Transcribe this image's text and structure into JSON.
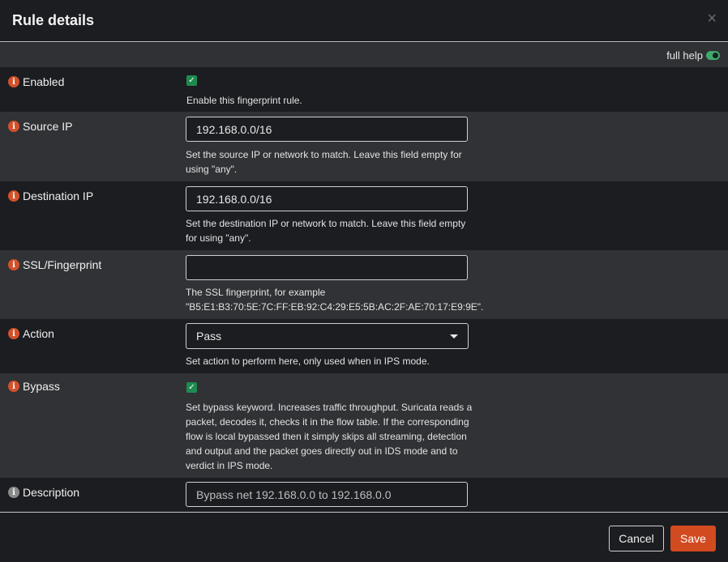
{
  "modal": {
    "title": "Rule details",
    "close_label": "×",
    "full_help_label": "full help"
  },
  "fields": {
    "enabled": {
      "label": "Enabled",
      "checked": true,
      "help": "Enable this fingerprint rule."
    },
    "source_ip": {
      "label": "Source IP",
      "value": "192.168.0.0/16",
      "help": "Set the source IP or network to match. Leave this field empty for using \"any\"."
    },
    "destination_ip": {
      "label": "Destination IP",
      "value": "192.168.0.0/16",
      "help": "Set the destination IP or network to match. Leave this field empty for using \"any\"."
    },
    "ssl_fingerprint": {
      "label": "SSL/Fingerprint",
      "value": "",
      "help": "The SSL fingerprint, for example \"B5:E1:B3:70:5E:7C:FF:EB:92:C4:29:E5:5B:AC:2F:AE:70:17:E9:9E\"."
    },
    "action": {
      "label": "Action",
      "selected": "Pass",
      "help": "Set action to perform here, only used when in IPS mode."
    },
    "bypass": {
      "label": "Bypass",
      "checked": true,
      "help": "Set bypass keyword. Increases traffic throughput. Suricata reads a packet, decodes it, checks it in the flow table. If the corresponding flow is local bypassed then it simply skips all streaming, detection and output and the packet goes directly out in IDS mode and to verdict in IPS mode."
    },
    "description": {
      "label": "Description",
      "value": "Bypass net 192.168.0.0 to 192.168.0.0"
    }
  },
  "footer": {
    "cancel_label": "Cancel",
    "save_label": "Save"
  },
  "colors": {
    "background": "#1c1d21",
    "row_alt": "#313235",
    "accent": "#d14a20",
    "check": "#1f8a4f"
  }
}
